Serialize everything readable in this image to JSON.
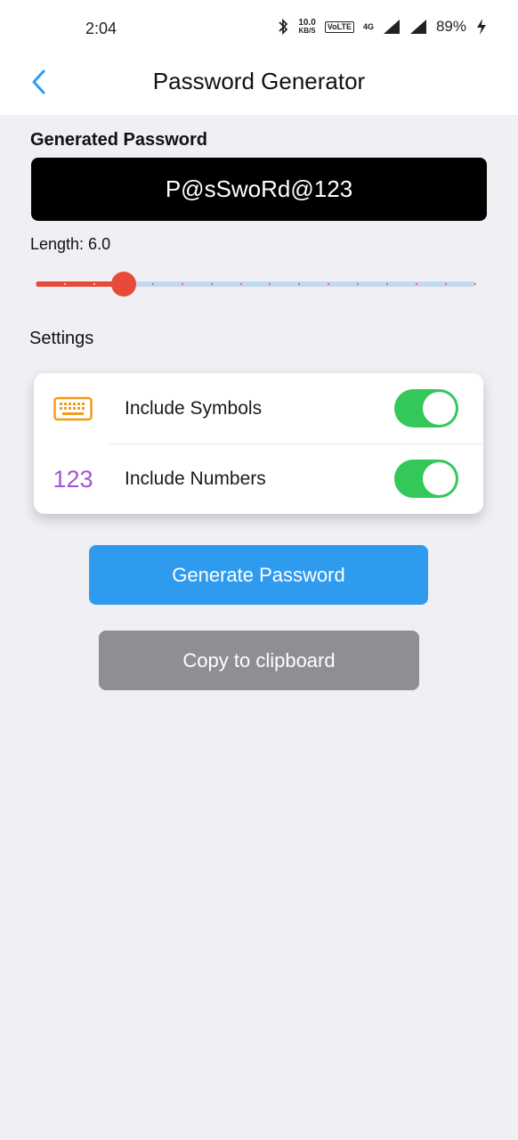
{
  "status": {
    "time": "2:04",
    "speed_value": "10.0",
    "speed_unit": "KB/S",
    "network": "4G",
    "battery": "89%"
  },
  "header": {
    "title": "Password Generator"
  },
  "password": {
    "label": "Generated Password",
    "value": "P@sSwoRd@123"
  },
  "length": {
    "label": "Length: 6.0",
    "value": 6,
    "min": 3,
    "max": 18,
    "ticks": 15
  },
  "settings": {
    "label": "Settings",
    "options": [
      {
        "label": "Include Symbols",
        "icon": "keyboard-icon",
        "on": true
      },
      {
        "label": "Include Numbers",
        "icon_text": "123",
        "icon": "numbers-icon",
        "on": true
      }
    ]
  },
  "actions": {
    "generate_label": "Generate Password",
    "copy_label": "Copy to clipboard"
  },
  "colors": {
    "accent": "#2f9bef",
    "slider": "#e84a3a",
    "toggle_on": "#34c759",
    "symbols_icon": "#f39c1a",
    "numbers_icon": "#a653d6"
  }
}
